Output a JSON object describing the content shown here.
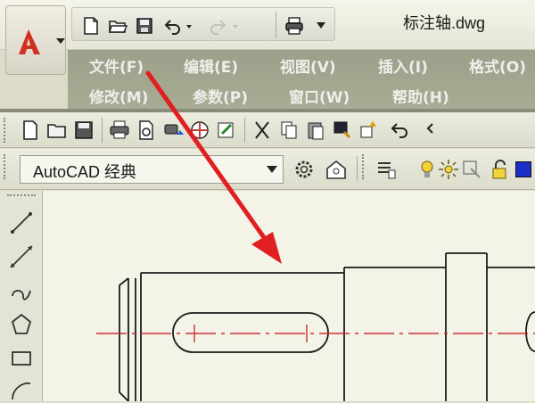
{
  "window": {
    "title": "标注轴.dwg"
  },
  "application_button": {
    "icon": "autocad-logo-icon"
  },
  "quick_access": {
    "items": [
      {
        "icon": "new-file-icon"
      },
      {
        "icon": "open-folder-icon"
      },
      {
        "icon": "save-icon"
      },
      {
        "icon": "undo-icon"
      },
      {
        "icon": "redo-icon"
      },
      {
        "icon": "print-icon"
      }
    ]
  },
  "menu": {
    "row1": [
      "文件(F)",
      "编辑(E)",
      "视图(V)",
      "插入(I)",
      "格式(O)"
    ],
    "row2": [
      "修改(M)",
      "参数(P)",
      "窗口(W)",
      "帮助(H)"
    ]
  },
  "workspace": {
    "selected": "AutoCAD 经典"
  },
  "draw_tools": [
    "line-icon",
    "construction-line-icon",
    "polyline-icon",
    "polygon-icon",
    "rectangle-icon",
    "arc-icon"
  ],
  "colors": {
    "annotation_arrow": "#e02020",
    "centerline": "#c83232",
    "menubar": "#a0a48c"
  }
}
